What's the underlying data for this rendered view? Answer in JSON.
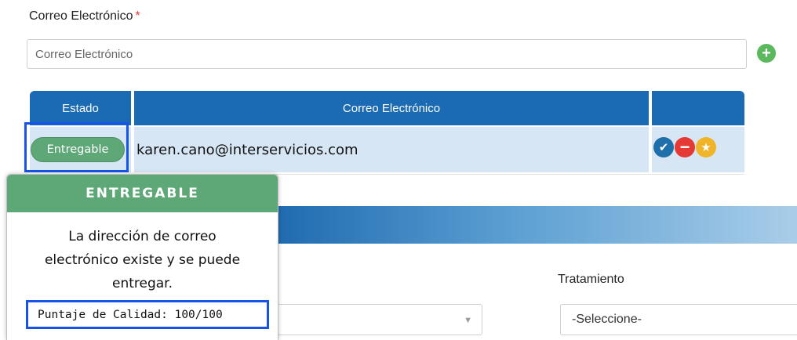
{
  "form": {
    "email_label": "Correo Electrónico",
    "required_mark": "*",
    "email_placeholder": "Correo Electrónico",
    "add_button": "+"
  },
  "table": {
    "headers": [
      "Estado",
      "Correo Electrónico",
      ""
    ],
    "rows": [
      {
        "status": "Entregable",
        "email": "karen.cano@interservicios.com"
      }
    ],
    "row_actions": [
      {
        "icon": "check-icon",
        "glyph": "✔",
        "color": "#1f6fab"
      },
      {
        "icon": "minus-icon",
        "glyph": "−",
        "color": "#e53935"
      },
      {
        "icon": "star-icon",
        "glyph": "★",
        "color": "#f0b429"
      }
    ]
  },
  "popover": {
    "title": "ENTREGABLE",
    "lines": [
      "La dirección de correo",
      "electrónico existe y se puede",
      "entregar."
    ],
    "score": "Puntaje de Calidad: 100/100"
  },
  "lower": {
    "tratamiento_label": "Tratamiento",
    "tratamiento_value": "-Seleccione-",
    "caret": "▼"
  },
  "colors": {
    "header_blue": "#1a6bb3",
    "row_bg": "#d6e6f5",
    "success_green": "#5ea877",
    "highlight_blue": "#1554e6",
    "required_red": "#e53935"
  }
}
